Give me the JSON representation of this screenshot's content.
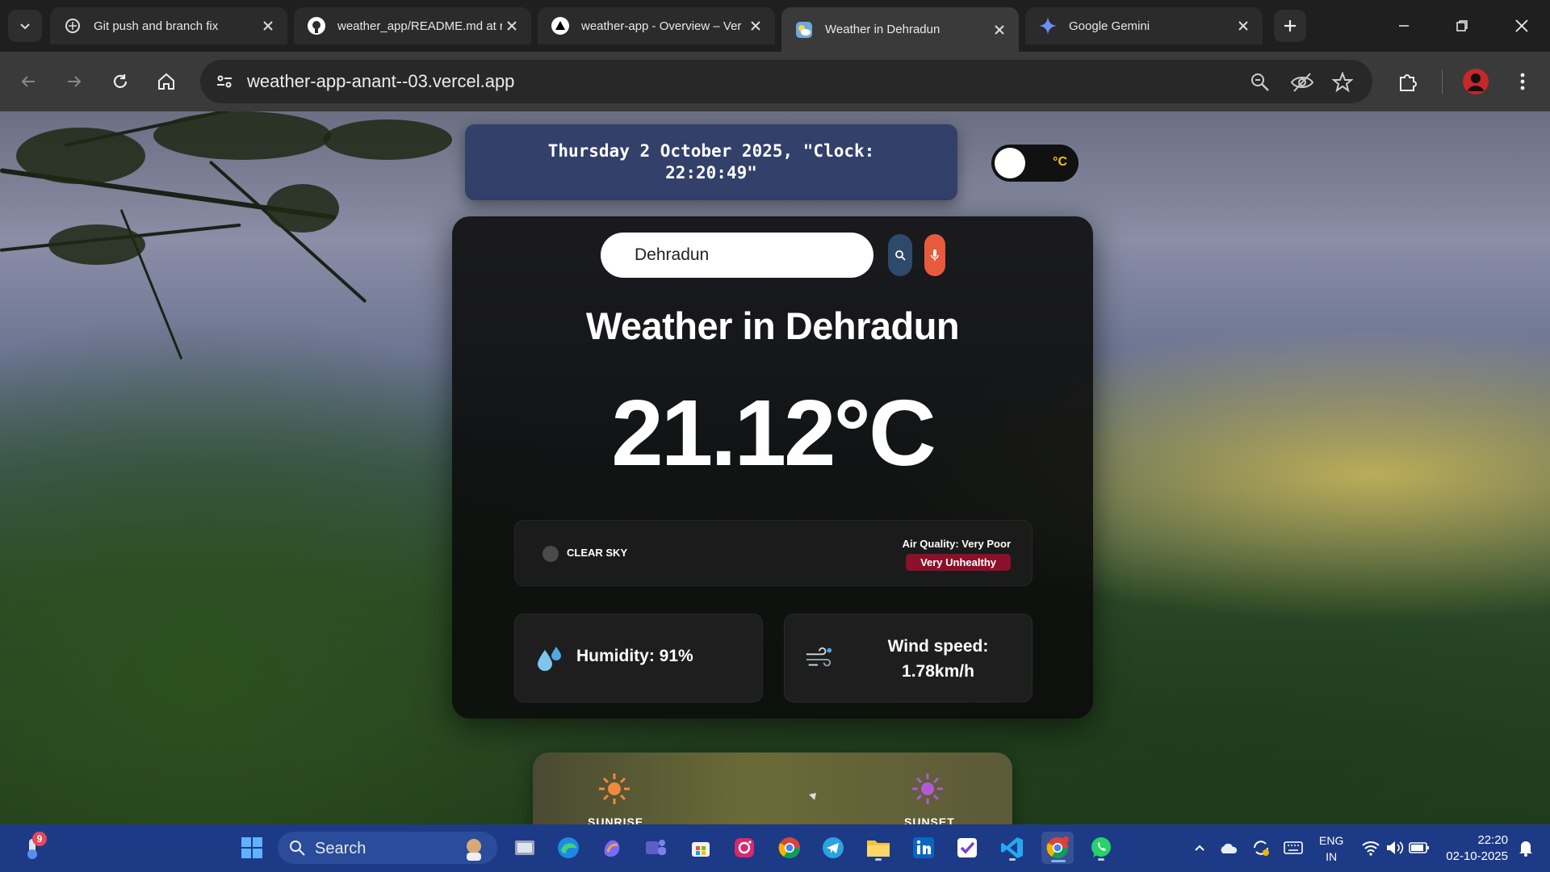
{
  "browser": {
    "tabs": [
      {
        "title": "Git push and branch fix",
        "icon": "chatgpt-icon",
        "active": false
      },
      {
        "title": "weather_app/README.md at r",
        "icon": "github-icon",
        "active": false
      },
      {
        "title": "weather-app - Overview – Ver",
        "icon": "vercel-icon",
        "active": false
      },
      {
        "title": "Weather in Dehradun",
        "icon": "weather-favicon-icon",
        "active": true
      },
      {
        "title": "Google Gemini",
        "icon": "gemini-icon",
        "active": false
      }
    ],
    "url": "weather-app-anant--03.vercel.app"
  },
  "page": {
    "clock_text": "Thursday 2 October 2025, \"Clock: 22:20:49\"",
    "unit_toggle_label": "°C",
    "search_value": "Dehradun",
    "city_title": "Weather in Dehradun",
    "temperature": "21.12°C",
    "condition": "CLEAR SKY",
    "air_quality_label": "Air Quality: Very Poor",
    "air_quality_badge": "Very Unhealthy",
    "humidity": "Humidity: 91%",
    "wind_label": "Wind speed:",
    "wind_value": "1.78km/h",
    "sunrise_label": "SUNRISE",
    "sunset_label": "SUNSET"
  },
  "taskbar": {
    "notification_count": "9",
    "search_label": "Search",
    "language_line1": "ENG",
    "language_line2": "IN",
    "time": "22:20",
    "date": "02-10-2025",
    "apps": [
      "file-explorer-icon",
      "edge-icon",
      "copilot-icon",
      "teams-icon",
      "store-icon",
      "instagram-icon",
      "chrome-icon",
      "telegram-icon",
      "folder-icon",
      "linkedin-icon",
      "todo-icon",
      "vscode-icon",
      "chrome-active-icon",
      "whatsapp-icon"
    ]
  },
  "colors": {
    "accent_toggle_text": "#f5c518",
    "clock_card_bg": "#33406a",
    "aq_badge_bg": "#8b1029",
    "mic_button": "#e85a3c",
    "taskbar_bg": "#1d3a86"
  }
}
